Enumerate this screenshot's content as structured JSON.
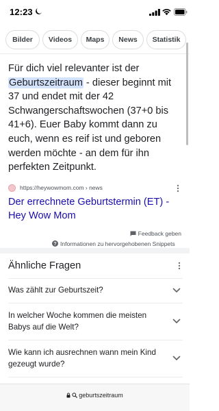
{
  "status_bar": {
    "time": "12:23"
  },
  "chips": [
    "Bilder",
    "Videos",
    "Maps",
    "News",
    "Statistik"
  ],
  "snippet": {
    "before": "Für dich viel relevanter ist der ",
    "highlight": "Geburtszeitraum",
    "after": " - dieser beginnt mit 37 und endet mit der 42 Schwangerschaftswochen (37+0 bis 41+6). Euer Baby kommt dann zu euch, wenn es reif ist und geboren werden möchte - an dem für ihn perfekten Zeitpunkt."
  },
  "source": {
    "url": "https://heywowmom.com › news",
    "title": "Der errechnete Geburtstermin (ET) - Hey Wow Mom"
  },
  "feedback_label": "Feedback geben",
  "info_label": "Informationen zu hervorgehobenen Snippets",
  "paa": {
    "heading": "Ähnliche Fragen",
    "questions": [
      "Was zählt zur Geburtszeit?",
      "In welcher Woche kommen die meisten Babys auf die Welt?",
      "Wie kann ich ausrechnen wann mein Kind gezeugt wurde?"
    ]
  },
  "address_bar": {
    "text": "geburtszeitraum"
  },
  "colors": {
    "link": "#1a0dab",
    "highlight": "#d3e3fd",
    "text": "#202124"
  }
}
